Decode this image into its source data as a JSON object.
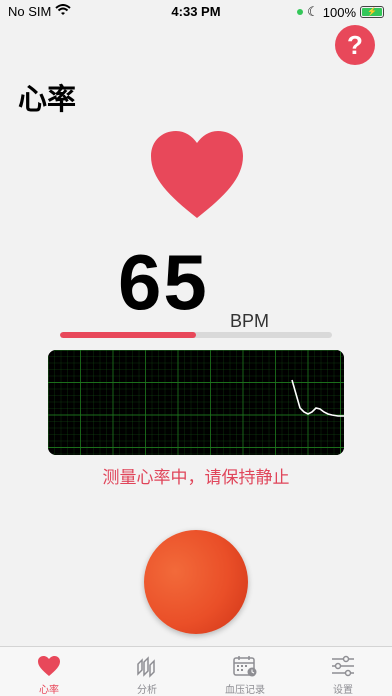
{
  "status_bar": {
    "carrier": "No SIM",
    "time": "4:33 PM",
    "battery": "100%"
  },
  "header": {
    "title": "心率",
    "help_label": "?"
  },
  "measurement": {
    "value": "65",
    "unit": "BPM",
    "progress": 0.5
  },
  "status_message": "测量心率中，请保持静止",
  "tabs": [
    {
      "label": "心率",
      "icon": "heart-icon",
      "active": true
    },
    {
      "label": "分析",
      "icon": "analysis-icon",
      "active": false
    },
    {
      "label": "血压记录",
      "icon": "calendar-icon",
      "active": false
    },
    {
      "label": "设置",
      "icon": "sliders-icon",
      "active": false
    }
  ],
  "colors": {
    "accent": "#e8485a",
    "button": "#ea4f28",
    "ecg_background": "#000000",
    "ecg_grid": "#1f7a1f",
    "ecg_trace": "#ffffff"
  }
}
